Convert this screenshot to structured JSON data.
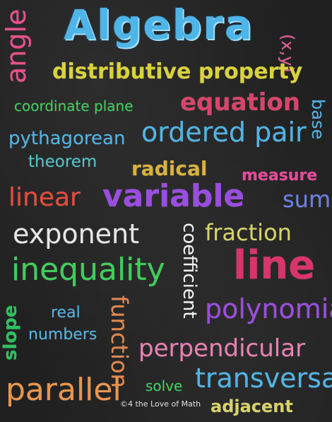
{
  "words": {
    "title": "Algebra",
    "xy": "(x,y)",
    "angle": "angle",
    "distributive": "distributive property",
    "coordinate": "coordinate plane",
    "equation": "equation",
    "base": "base",
    "pythagorean": "pythagorean",
    "ordered": "ordered pair",
    "theorem": "theorem",
    "radical": "radical",
    "measure": "measure",
    "linear": "linear",
    "variable": "variable",
    "sum": "sum",
    "exponent": "exponent",
    "coefficient": "coefficient",
    "fraction": "fraction",
    "inequality": "inequality",
    "line": "line",
    "slope": "slope",
    "real": "real",
    "numbers": "numbers",
    "function": "function",
    "polynomial": "polynomial",
    "perpendicular": "perpendicular",
    "parallel": "parallel",
    "solve": "solve",
    "transversal": "transversal",
    "adjacent": "adjacent"
  },
  "credit": "©4 the Love of Math",
  "colors": {
    "background": "#202020",
    "blue": "#4fb4e6",
    "pink": "#e84a9a",
    "yellow": "#d9d23c",
    "green": "#3ecf5a",
    "purple": "#9a4de0",
    "red": "#d8356a",
    "orange": "#e8964f"
  }
}
